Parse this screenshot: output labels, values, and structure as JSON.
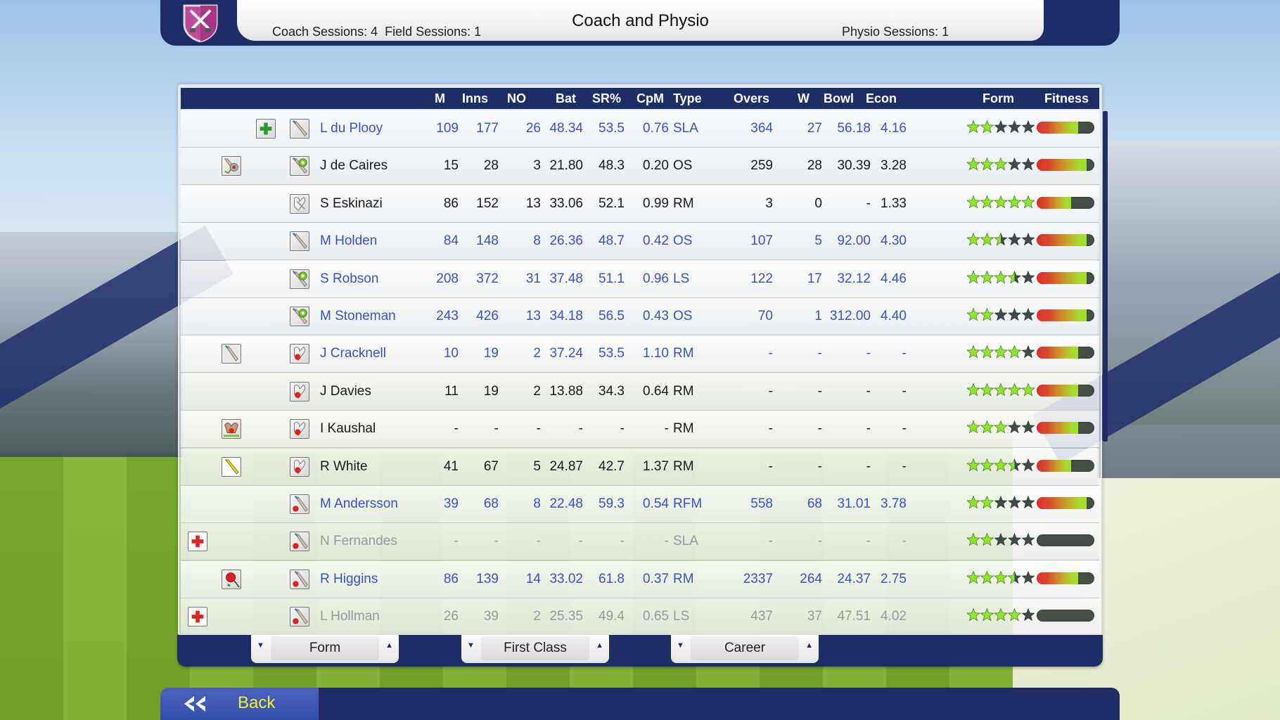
{
  "header": {
    "title": "Coach and Physio",
    "coach_sessions": "Coach Sessions: 4",
    "field_sessions": "Field Sessions: 1",
    "physio_sessions": "Physio Sessions: 1",
    "team_logo": "shield-crossed-swords-icon",
    "logo_color": "#b8398f"
  },
  "table": {
    "columns": [
      "M",
      "Inns",
      "NO",
      "Bat",
      "SR%",
      "CpM",
      "Type",
      "Overs",
      "W",
      "Bowl",
      "Econ",
      "Form",
      "Fitness"
    ],
    "rows": [
      {
        "name": "L du Plooy",
        "status_icon": "physio-plus-icon",
        "role_icon": "bat-icon",
        "style": "blue",
        "M": "109",
        "Inns": "177",
        "NO": "26",
        "Bat": "48.34",
        "SR": "53.5",
        "CpM": "0.76",
        "Type": "SLA",
        "Overs": "364",
        "W": "27",
        "Bowl": "56.18",
        "Econ": "4.16",
        "form": 2,
        "fitness": 0.72
      },
      {
        "name": "J de Caires",
        "status_icon": "fielding-training-icon",
        "role_icon": "bat-ball-icon",
        "style": "normal",
        "M": "15",
        "Inns": "28",
        "NO": "3",
        "Bat": "21.80",
        "SR": "48.3",
        "CpM": "0.20",
        "Type": "OS",
        "Overs": "259",
        "W": "28",
        "Bowl": "30.39",
        "Econ": "3.28",
        "form": 3,
        "fitness": 0.86
      },
      {
        "name": "S Eskinazi",
        "status_icon": "",
        "role_icon": "keeper-gloves-icon",
        "style": "normal",
        "M": "86",
        "Inns": "152",
        "NO": "13",
        "Bat": "33.06",
        "SR": "52.1",
        "CpM": "0.99",
        "Type": "RM",
        "Overs": "3",
        "W": "0",
        "Bowl": "-",
        "Econ": "1.33",
        "form": 5,
        "fitness": 0.6
      },
      {
        "name": "M Holden",
        "status_icon": "",
        "role_icon": "bat-icon",
        "style": "blue",
        "M": "84",
        "Inns": "148",
        "NO": "8",
        "Bat": "26.36",
        "SR": "48.7",
        "CpM": "0.42",
        "Type": "OS",
        "Overs": "107",
        "W": "5",
        "Bowl": "92.00",
        "Econ": "4.30",
        "form": 2.5,
        "fitness": 0.86
      },
      {
        "name": "S Robson",
        "status_icon": "",
        "role_icon": "bat-ball-icon",
        "style": "blue",
        "M": "208",
        "Inns": "372",
        "NO": "31",
        "Bat": "37.48",
        "SR": "51.1",
        "CpM": "0.96",
        "Type": "LS",
        "Overs": "122",
        "W": "17",
        "Bowl": "32.12",
        "Econ": "4.46",
        "form": 3.5,
        "fitness": 0.86
      },
      {
        "name": "M Stoneman",
        "status_icon": "",
        "role_icon": "bat-ball-icon",
        "style": "blue",
        "M": "243",
        "Inns": "426",
        "NO": "13",
        "Bat": "34.18",
        "SR": "56.5",
        "CpM": "0.43",
        "Type": "OS",
        "Overs": "70",
        "W": "1",
        "Bowl": "312.00",
        "Econ": "4.40",
        "form": 2,
        "fitness": 0.86
      },
      {
        "name": "J Cracknell",
        "status_icon": "batting-training-icon",
        "role_icon": "gloves-ball-icon",
        "style": "blue",
        "M": "10",
        "Inns": "19",
        "NO": "2",
        "Bat": "37.24",
        "SR": "53.5",
        "CpM": "1.10",
        "Type": "RM",
        "Overs": "-",
        "W": "-",
        "Bowl": "-",
        "Econ": "-",
        "form": 4,
        "fitness": 0.72
      },
      {
        "name": "J Davies",
        "status_icon": "",
        "role_icon": "gloves-ball-icon",
        "style": "normal",
        "M": "11",
        "Inns": "19",
        "NO": "2",
        "Bat": "13.88",
        "SR": "34.3",
        "CpM": "0.64",
        "Type": "RM",
        "Overs": "-",
        "W": "-",
        "Bowl": "-",
        "Econ": "-",
        "form": 5,
        "fitness": 0.72
      },
      {
        "name": "I Kaushal",
        "status_icon": "keeping-training-icon",
        "role_icon": "gloves-ball-icon",
        "style": "normal",
        "M": "-",
        "Inns": "-",
        "NO": "-",
        "Bat": "-",
        "SR": "-",
        "CpM": "-",
        "Type": "RM",
        "Overs": "-",
        "W": "-",
        "Bowl": "-",
        "Econ": "-",
        "form": 3,
        "fitness": 0.72
      },
      {
        "name": "R White",
        "status_icon": "yellow-bat-training-icon",
        "role_icon": "gloves-ball-icon",
        "style": "normal",
        "M": "41",
        "Inns": "67",
        "NO": "5",
        "Bat": "24.87",
        "SR": "42.7",
        "CpM": "1.37",
        "Type": "RM",
        "Overs": "-",
        "W": "-",
        "Bowl": "-",
        "Econ": "-",
        "form": 3.5,
        "fitness": 0.6
      },
      {
        "name": "M Andersson",
        "status_icon": "",
        "role_icon": "bat-red-ball-icon",
        "style": "blue",
        "M": "39",
        "Inns": "68",
        "NO": "8",
        "Bat": "22.48",
        "SR": "59.3",
        "CpM": "0.54",
        "Type": "RFM",
        "Overs": "558",
        "W": "68",
        "Bowl": "31.01",
        "Econ": "3.78",
        "form": 2,
        "fitness": 0.86
      },
      {
        "name": "N Fernandes",
        "status_icon": "injury-cross-icon",
        "role_icon": "bat-red-ball-icon",
        "style": "grey",
        "M": "-",
        "Inns": "-",
        "NO": "-",
        "Bat": "-",
        "SR": "-",
        "CpM": "-",
        "Type": "SLA",
        "Overs": "-",
        "W": "-",
        "Bowl": "-",
        "Econ": "-",
        "form": 2,
        "fitness": 0
      },
      {
        "name": "R Higgins",
        "status_icon": "bowling-training-icon",
        "role_icon": "bat-red-ball-icon",
        "style": "blue",
        "M": "86",
        "Inns": "139",
        "NO": "14",
        "Bat": "33.02",
        "SR": "61.8",
        "CpM": "0.37",
        "Type": "RM",
        "Overs": "2337",
        "W": "264",
        "Bowl": "24.37",
        "Econ": "2.75",
        "form": 3.5,
        "fitness": 0.72
      },
      {
        "name": "L Hollman",
        "status_icon": "injury-cross-icon",
        "role_icon": "bat-red-ball-icon",
        "style": "grey",
        "M": "26",
        "Inns": "39",
        "NO": "2",
        "Bat": "25.35",
        "SR": "49.4",
        "CpM": "0.65",
        "Type": "LS",
        "Overs": "437",
        "W": "37",
        "Bowl": "47.51",
        "Econ": "4.02",
        "form": 4,
        "fitness": 0
      }
    ]
  },
  "filters": {
    "sort": "Form",
    "competition": "First Class",
    "period": "Career"
  },
  "footer": {
    "back_label": "Back"
  },
  "colors": {
    "navy": "#1f2d66",
    "link_blue": "#3c52c4",
    "star_on": "#8ee62a",
    "star_off": "#3e4a48",
    "back_text": "#f6ee2c"
  }
}
